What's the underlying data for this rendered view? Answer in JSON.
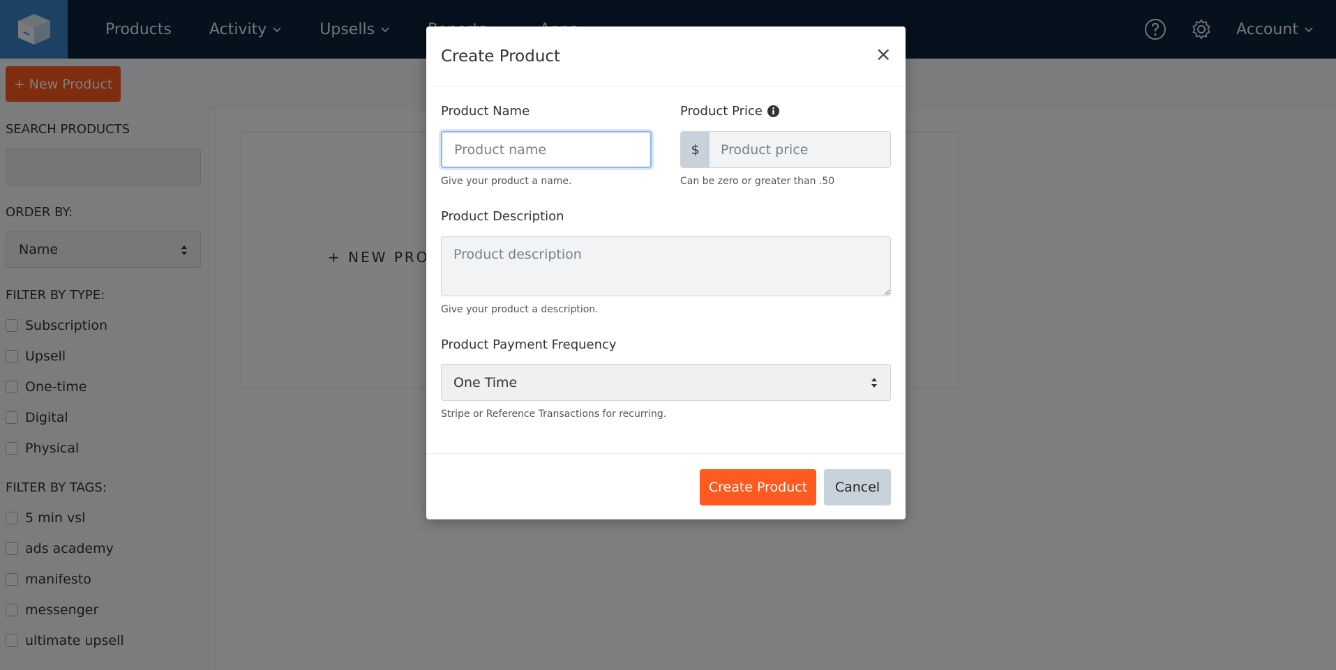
{
  "nav": {
    "items": [
      {
        "label": "Products",
        "has_dropdown": false
      },
      {
        "label": "Activity",
        "has_dropdown": true
      },
      {
        "label": "Upsells",
        "has_dropdown": true
      },
      {
        "label": "Reports",
        "has_dropdown": true
      },
      {
        "label": "Apps",
        "has_dropdown": true
      }
    ],
    "account_label": "Account",
    "icons": [
      "box-logo-icon",
      "help-icon",
      "gear-icon"
    ]
  },
  "toolbar": {
    "new_product_label": "+ New Product"
  },
  "sidebar": {
    "search_heading": "SEARCH PRODUCTS",
    "order_heading": "ORDER BY:",
    "order_value": "Name",
    "type_heading": "FILTER BY TYPE:",
    "types": [
      "Subscription",
      "Upsell",
      "One-time",
      "Digital",
      "Physical"
    ],
    "tags_heading": "FILTER BY TAGS:",
    "tags": [
      "5 min vsl",
      "ads academy",
      "manifesto",
      "messenger",
      "ultimate upsell"
    ]
  },
  "main": {
    "new_product_link": "+ NEW PRODUCT"
  },
  "modal": {
    "title": "Create Product",
    "close_glyph": "×",
    "name_label": "Product Name",
    "name_placeholder": "Product name",
    "name_help": "Give your product a name.",
    "price_label": "Product Price",
    "price_addon": "$",
    "price_placeholder": "Product price",
    "price_help": "Can be zero or greater than .50",
    "desc_label": "Product Description",
    "desc_placeholder": "Product description",
    "desc_help": "Give your product a description.",
    "freq_label": "Product Payment Frequency",
    "freq_value": "One Time",
    "freq_help": "Stripe or Reference Transactions for recurring.",
    "create_label": "Create Product",
    "cancel_label": "Cancel"
  },
  "colors": {
    "nav_bg": "#0b2239",
    "logo_bg": "#3b82c4",
    "accent": "#ff5a1f",
    "cancel_bg": "#c9d2db"
  }
}
